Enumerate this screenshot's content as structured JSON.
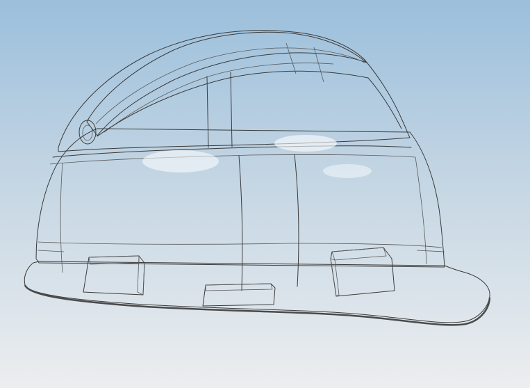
{
  "viewport": {
    "background_top": "#9bbfdc",
    "background_bottom": "#eceef0",
    "model_color": "#c9c9c9",
    "edge_color": "#3a3a3a"
  },
  "model": {
    "subject": "safety-helmet-3d-model",
    "visible_text": []
  }
}
